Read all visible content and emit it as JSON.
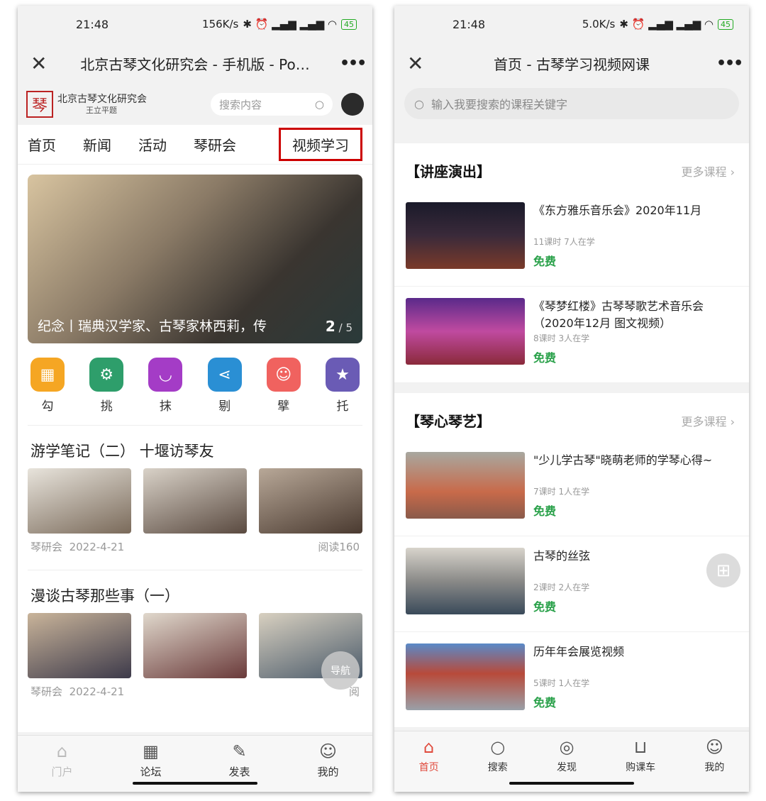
{
  "left": {
    "status": {
      "time": "21:48",
      "speed": "156K/s",
      "battery": "45"
    },
    "title": "北京古琴文化研究会 - 手机版 - Po…",
    "logo": {
      "mark": "琴",
      "name": "北京古琴文化研究会",
      "sub": "王立平题"
    },
    "search_placeholder": "搜索内容",
    "nav": [
      "首页",
      "新闻",
      "活动",
      "琴研会",
      "视频学习"
    ],
    "banner": {
      "caption": "纪念丨瑞典汉学家、古琴家林西莉，传",
      "page_current": "2",
      "page_total": "/ 5"
    },
    "icons": [
      {
        "label": "勾",
        "color": "#f5a623",
        "icon": "grid-icon"
      },
      {
        "label": "挑",
        "color": "#2e9e6b",
        "icon": "gear-icon"
      },
      {
        "label": "抹",
        "color": "#a43cc6",
        "icon": "smile-icon"
      },
      {
        "label": "剔",
        "color": "#2a8fd4",
        "icon": "share-icon"
      },
      {
        "label": "擘",
        "color": "#f0625f",
        "icon": "face-icon"
      },
      {
        "label": "托",
        "color": "#6a5bb5",
        "icon": "star-icon"
      }
    ],
    "articles": [
      {
        "title": "游学笔记（二） 十堰访琴友",
        "source": "琴研会",
        "date": "2022-4-21",
        "reads": "阅读160"
      },
      {
        "title": "漫谈古琴那些事（一）",
        "source": "琴研会",
        "date": "2022-4-21",
        "reads": "阅"
      }
    ],
    "float_nav": "导航",
    "tabbar": [
      "门户",
      "论坛",
      "发表",
      "我的"
    ]
  },
  "right": {
    "status": {
      "time": "21:48",
      "speed": "5.0K/s",
      "battery": "45"
    },
    "title": "首页 - 古琴学习视频网课",
    "search_placeholder": "输入我要搜索的课程关键字",
    "sections": [
      {
        "title": "【讲座演出】",
        "more": "更多课程",
        "courses": [
          {
            "name": "《东方雅乐音乐会》2020年11月",
            "stats": "11课时 7人在学",
            "price": "免费"
          },
          {
            "name": "《琴梦红楼》古琴琴歌艺术音乐会（2020年12月 图文视频）",
            "stats": "8课时 3人在学",
            "price": "免费"
          }
        ]
      },
      {
        "title": "【琴心琴艺】",
        "more": "更多课程",
        "courses": [
          {
            "name": "\"少儿学古琴\"晓萌老师的学琴心得~",
            "stats": "7课时 1人在学",
            "price": "免费"
          },
          {
            "name": "古琴的丝弦",
            "stats": "2课时 2人在学",
            "price": "免费"
          },
          {
            "name": "历年年会展览视频",
            "stats": "5课时 1人在学",
            "price": "免费"
          }
        ]
      }
    ],
    "tabbar": [
      "首页",
      "搜索",
      "发现",
      "购课车",
      "我的"
    ]
  }
}
